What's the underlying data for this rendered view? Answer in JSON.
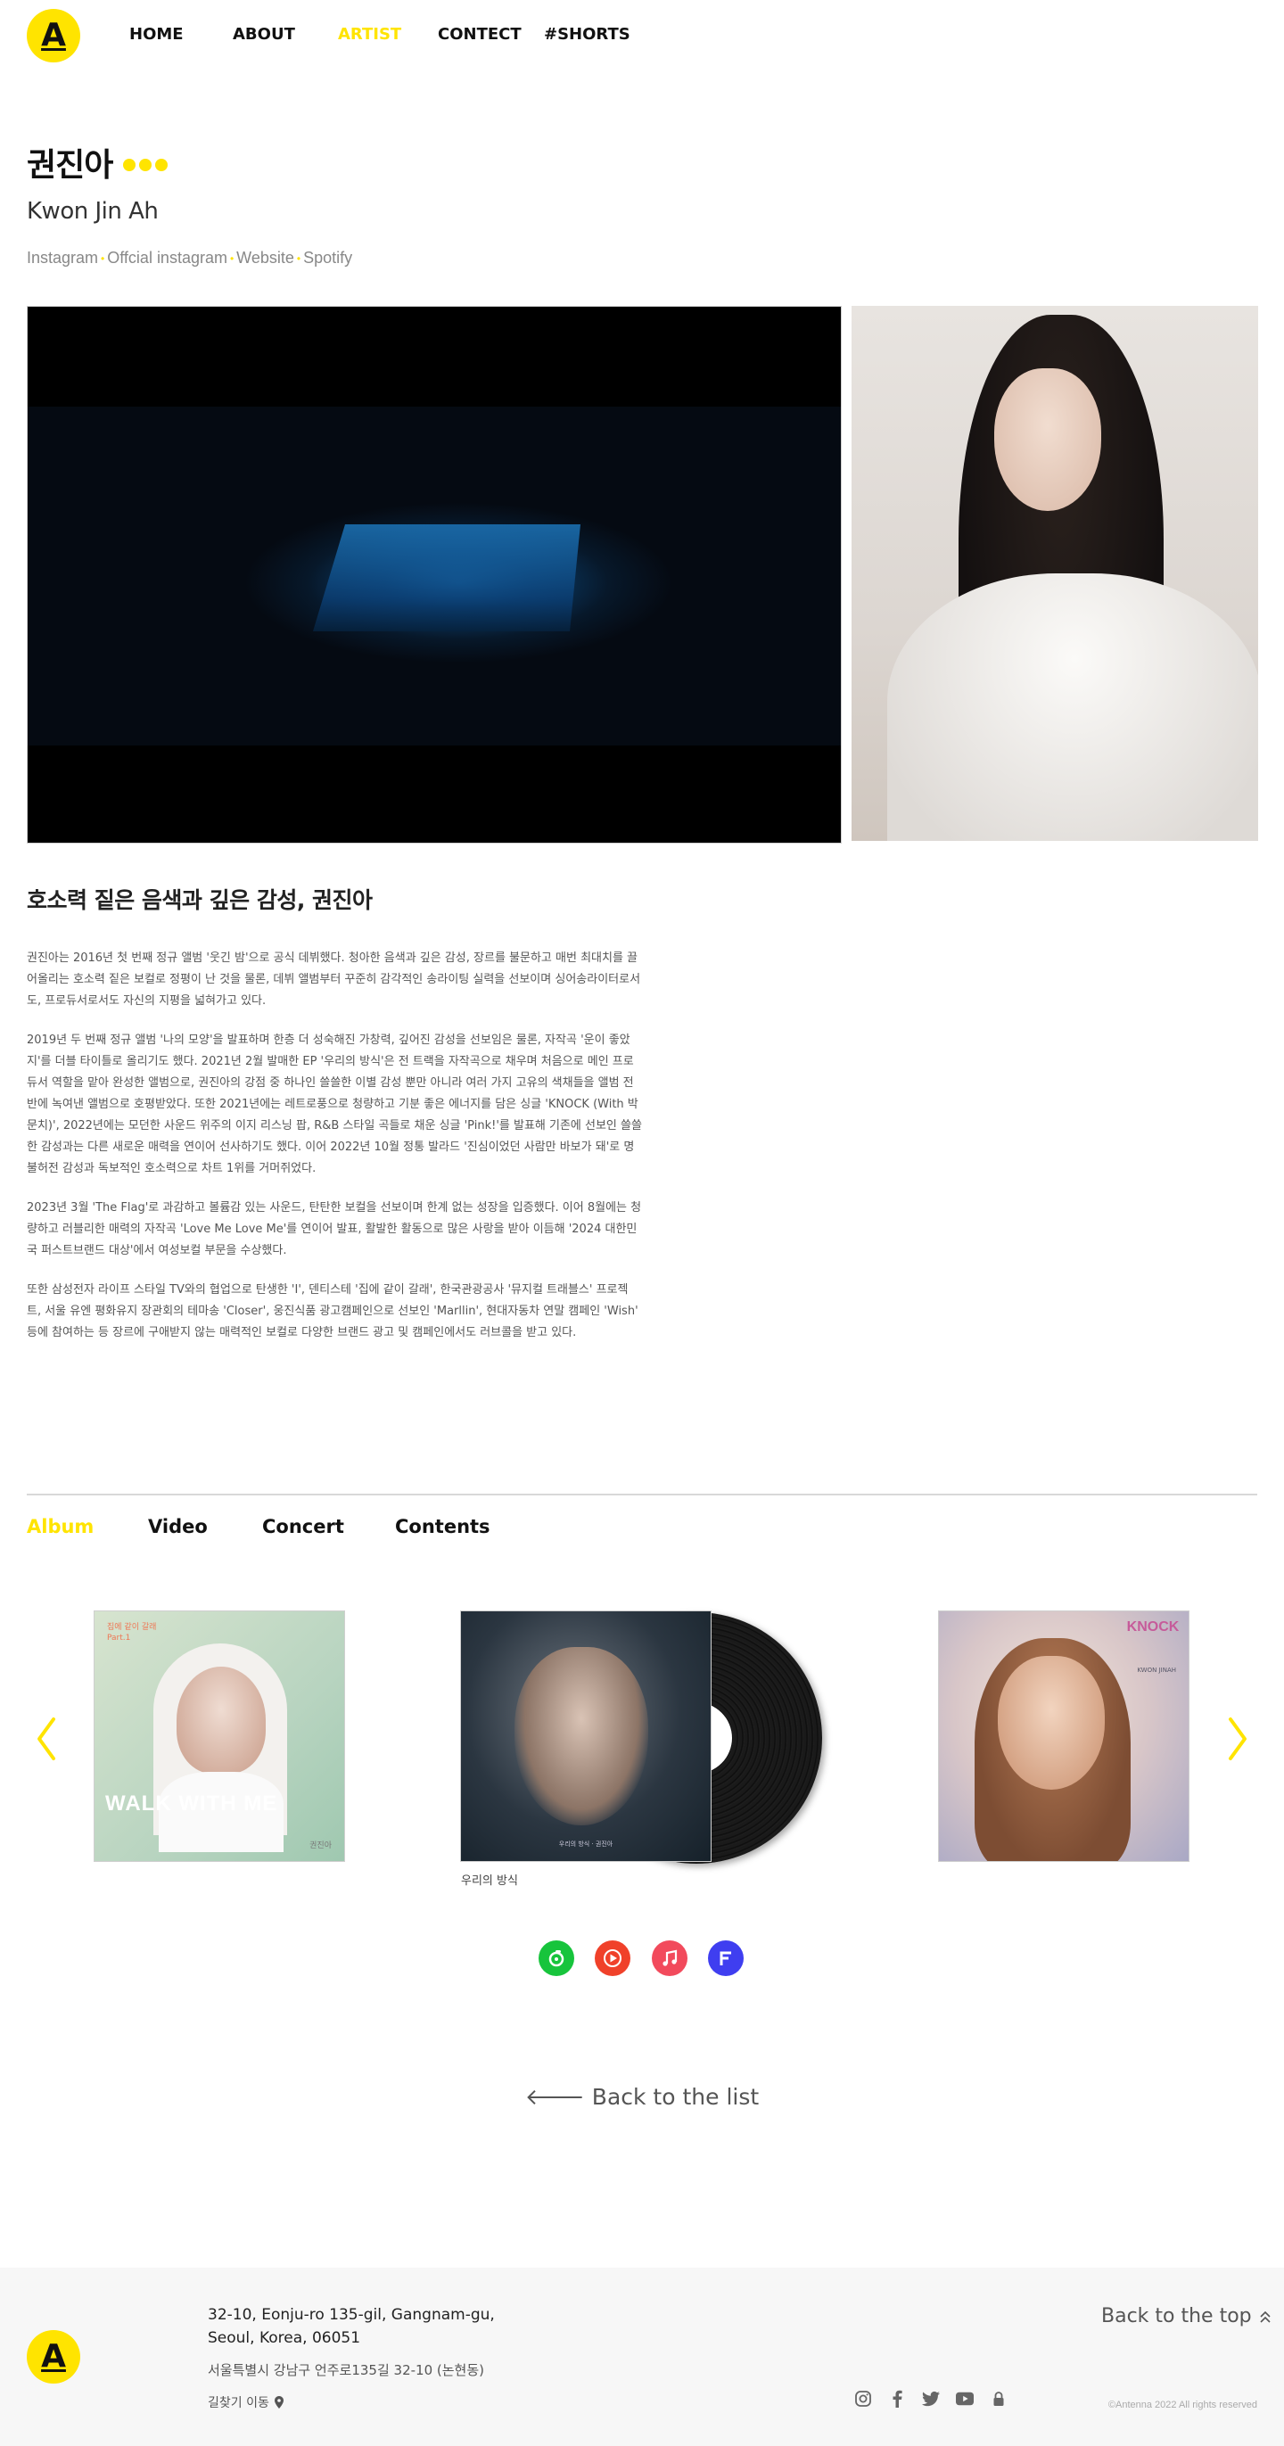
{
  "header": {
    "logo_letter": "A",
    "nav": [
      {
        "label": "HOME",
        "active": false
      },
      {
        "label": "ABOUT",
        "active": false
      },
      {
        "label": "ARTIST",
        "active": true
      },
      {
        "label": "CONTECT",
        "active": false
      },
      {
        "label": "#SHORTS",
        "active": false
      }
    ]
  },
  "artist": {
    "name_kr": "권진아",
    "name_en": "Kwon Jin Ah",
    "links": [
      "Instagram",
      "Offcial instagram",
      "Website",
      "Spotify"
    ]
  },
  "bio": {
    "title": "호소력 짙은 음색과 깊은 감성, 권진아",
    "paragraphs": [
      "권진아는 2016년 첫 번째 정규 앨범 '웃긴 밤'으로 공식 데뷔했다. 청아한 음색과 깊은 감성, 장르를 불문하고 매번 최대치를 끌어올리는 호소력 짙은 보컬로 정평이 난 것을 물론, 데뷔 앨범부터 꾸준히 감각적인 송라이팅 실력을 선보이며 싱어송라이터로서도, 프로듀서로서도 자신의 지평을 넓혀가고 있다.",
      "2019년 두 번째 정규 앨범 '나의 모양'을 발표하며 한층 더 성숙해진 가창력, 깊어진 감성을 선보임은 물론, 자작곡 '운이 좋았지'를 더블 타이틀로 올리기도 했다. 2021년 2월 발매한 EP '우리의 방식'은 전 트랙을 자작곡으로 채우며 처음으로 메인 프로듀서 역할을 맡아 완성한 앨범으로, 권진아의 강점 중 하나인 쓸쓸한 이별 감성 뿐만 아니라 여러 가지 고유의 색채들을 앨범 전반에 녹여낸 앨범으로 호평받았다. 또한 2021년에는 레트로풍으로 청량하고 기분 좋은 에너지를 담은 싱글 'KNOCK (With 박문치)', 2022년에는 모던한 사운드 위주의 이지 리스닝 팝, R&B 스타일 곡들로 채운 싱글 'Pink!'를 발표해 기존에 선보인 쓸쓸한 감성과는 다른 새로운 매력을 연이어 선사하기도 했다. 이어 2022년 10월 정통 발라드 '진심이었던 사람만 바보가 돼'로 명불허전 감성과 독보적인 호소력으로 차트 1위를 거머쥐었다.",
      "2023년 3월 'The Flag'로 과감하고 볼륨감 있는 사운드, 탄탄한 보컬을 선보이며 한계 없는 성장을 입증했다. 이어 8월에는 청량하고 러블리한 매력의 자작곡 'Love Me Love Me'를 연이어 발표, 활발한 활동으로 많은 사랑을 받아 이듬해 '2024 대한민국 퍼스트브랜드 대상'에서 여성보컬 부문을 수상했다.",
      "또한 삼성전자 라이프 스타일 TV와의 협업으로 탄생한 'I', 덴티스테 '집에 같이 갈래', 한국관광공사 '뮤지컬 트래블스' 프로젝트, 서울 유엔 평화유지 장관회의 테마송 'Closer', 웅진식품 광고캠페인으로 선보인 'Marllin', 현대자동차 연말 캠페인 'Wish' 등에 참여하는 등 장르에 구애받지 않는 매력적인 보컬로 다양한 브랜드 광고 및 캠페인에서도 러브콜을 받고 있다."
    ]
  },
  "tabs": [
    {
      "label": "Album",
      "active": true
    },
    {
      "label": "Video",
      "active": false
    },
    {
      "label": "Concert",
      "active": false
    },
    {
      "label": "Contents",
      "active": false
    }
  ],
  "albums": {
    "album1": {
      "top_text": "집에 같이 갈래",
      "part": "Part.1",
      "cover_title": "WALK WITH ME",
      "artist": "권진아"
    },
    "album2": {
      "caption": "우리의 방식",
      "cover_small": "우리의 방식 · 권진아"
    },
    "album3": {
      "cover_title": "KNOCK",
      "cover_sub": "KWON JINAH"
    }
  },
  "streaming": [
    {
      "name": "melon",
      "color": "#17c43c",
      "icon": "note-icon"
    },
    {
      "name": "youtube-music",
      "color": "#f0412a",
      "icon": "play-icon"
    },
    {
      "name": "apple-music",
      "color": "#f24a5c",
      "icon": "music-note-icon"
    },
    {
      "name": "flo",
      "color": "#3f3ef0",
      "icon": "f-icon"
    }
  ],
  "back_to_list": "Back to the list",
  "footer": {
    "address_line1": "32-10, Eonju-ro 135-gil, Gangnam-gu,",
    "address_line2": "Seoul, Korea, 06051",
    "address_kr": "서울특별시 강남구 언주로135길 32-10 (논현동)",
    "directions": "길찾기 이동",
    "back_to_top": "Back to the top",
    "copyright": "©Antenna 2022 All rights reserved"
  },
  "colors": {
    "accent": "#ffe400",
    "text": "#111111",
    "muted": "#888888"
  }
}
